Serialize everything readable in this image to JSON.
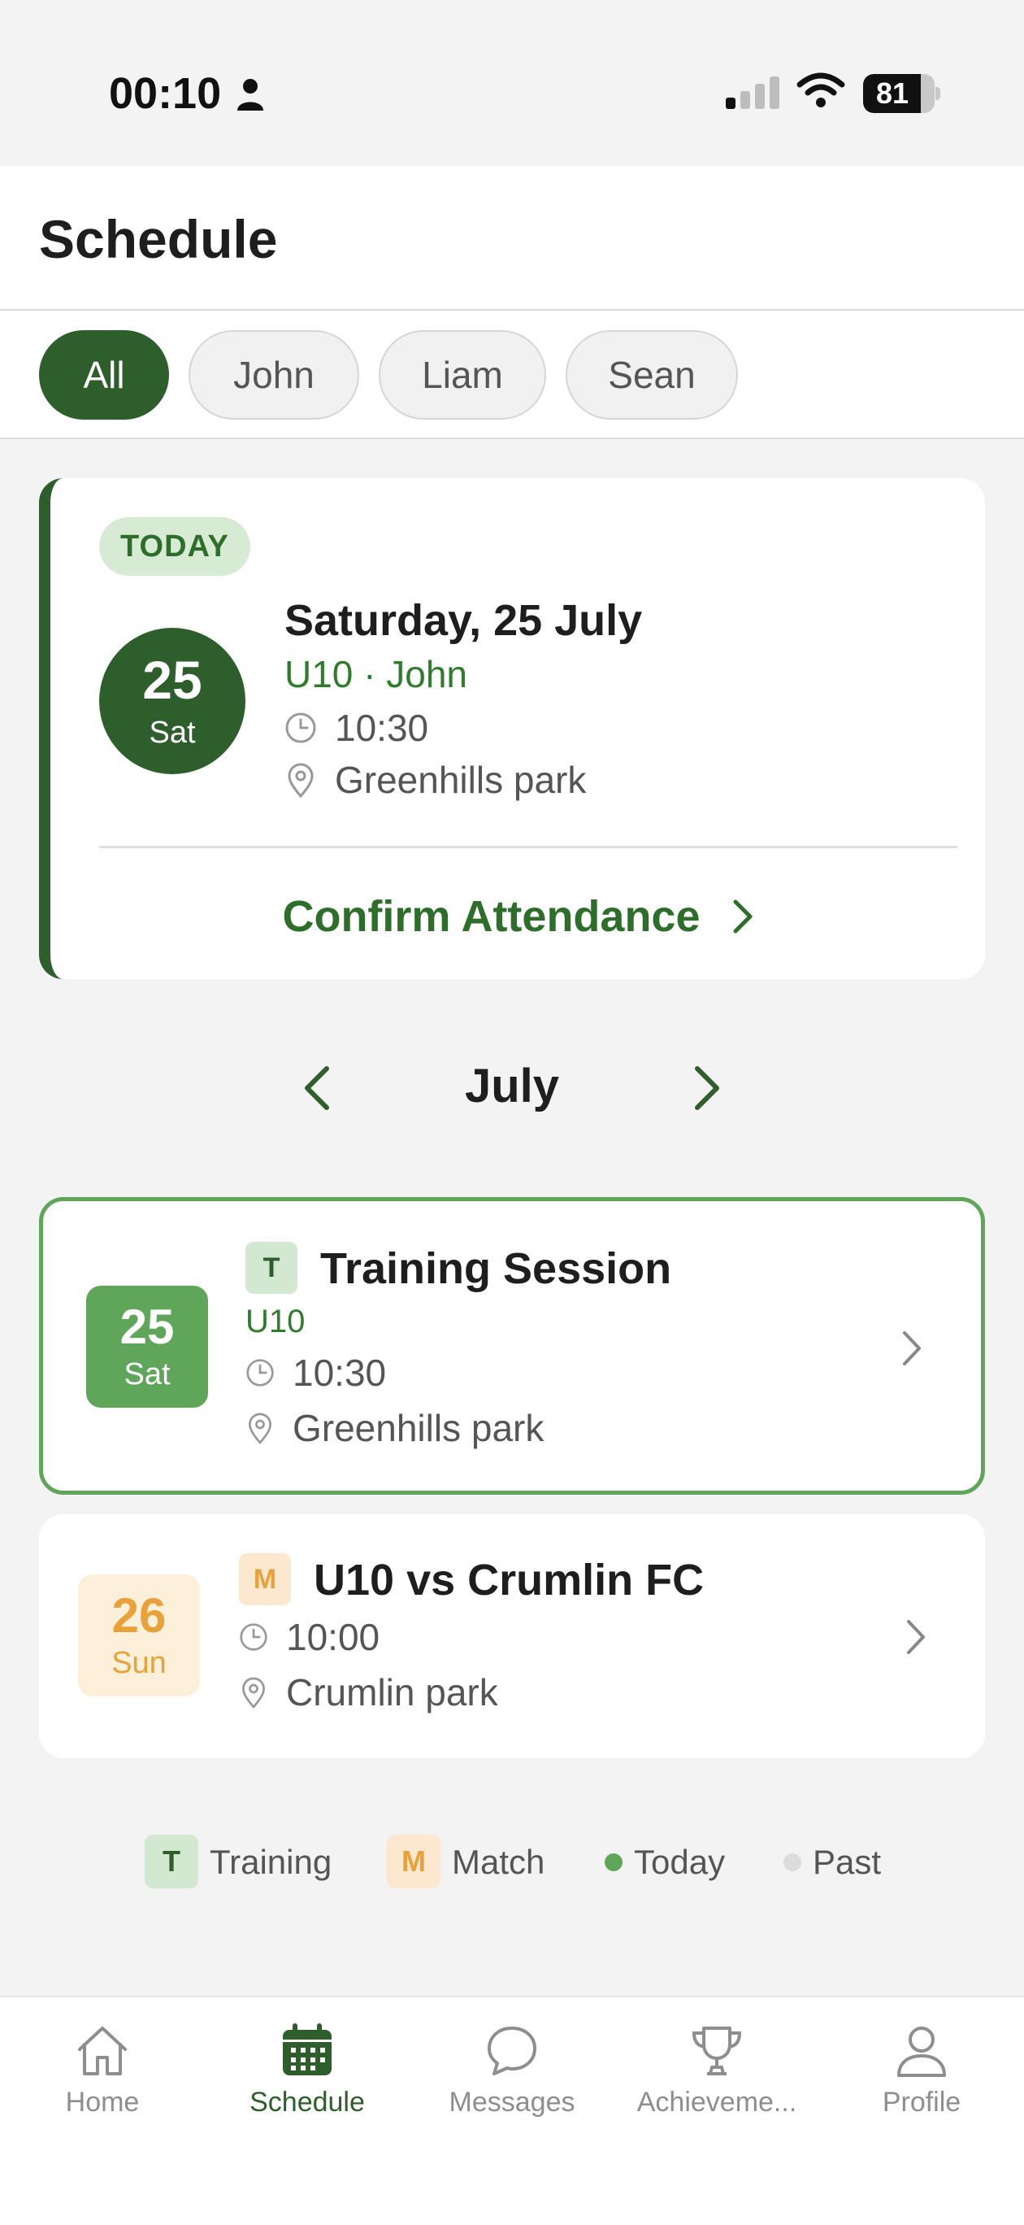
{
  "status_bar": {
    "time": "00:10",
    "battery_level": 81,
    "battery_label": "81"
  },
  "header": {
    "title": "Schedule"
  },
  "filters": {
    "chips": [
      {
        "label": "All",
        "active": true
      },
      {
        "label": "John",
        "active": false
      },
      {
        "label": "Liam",
        "active": false
      },
      {
        "label": "Sean",
        "active": false
      }
    ]
  },
  "today_card": {
    "badge": "TODAY",
    "day_number": "25",
    "weekday": "Sat",
    "date_label": "Saturday, 25 July",
    "team": "U10 · John",
    "time": "10:30",
    "location": "Greenhills park",
    "action_label": "Confirm Attendance"
  },
  "month_nav": {
    "month": "July"
  },
  "events": [
    {
      "day_number": "25",
      "weekday": "Sat",
      "type_letter": "T",
      "title": "Training Session",
      "team": "U10",
      "time": "10:30",
      "location": "Greenhills park"
    },
    {
      "day_number": "26",
      "weekday": "Sun",
      "type_letter": "M",
      "title": "U10 vs Crumlin FC",
      "time": "10:00",
      "location": "Crumlin park"
    }
  ],
  "legend": {
    "training_letter": "T",
    "training_label": "Training",
    "match_letter": "M",
    "match_label": "Match",
    "today_label": "Today",
    "past_label": "Past"
  },
  "tabbar": {
    "tabs": [
      {
        "label": "Home",
        "icon": "home-icon"
      },
      {
        "label": "Schedule",
        "icon": "calendar-icon",
        "active": true
      },
      {
        "label": "Messages",
        "icon": "chat-bubble-icon"
      },
      {
        "label": "Achieveme...",
        "icon": "trophy-icon"
      },
      {
        "label": "Profile",
        "icon": "person-icon"
      }
    ]
  },
  "colors": {
    "brand_green": "#2d5e2b",
    "accent_green": "#5fa65b",
    "match_orange": "#e9a13b",
    "background": "#f3f3f3"
  }
}
